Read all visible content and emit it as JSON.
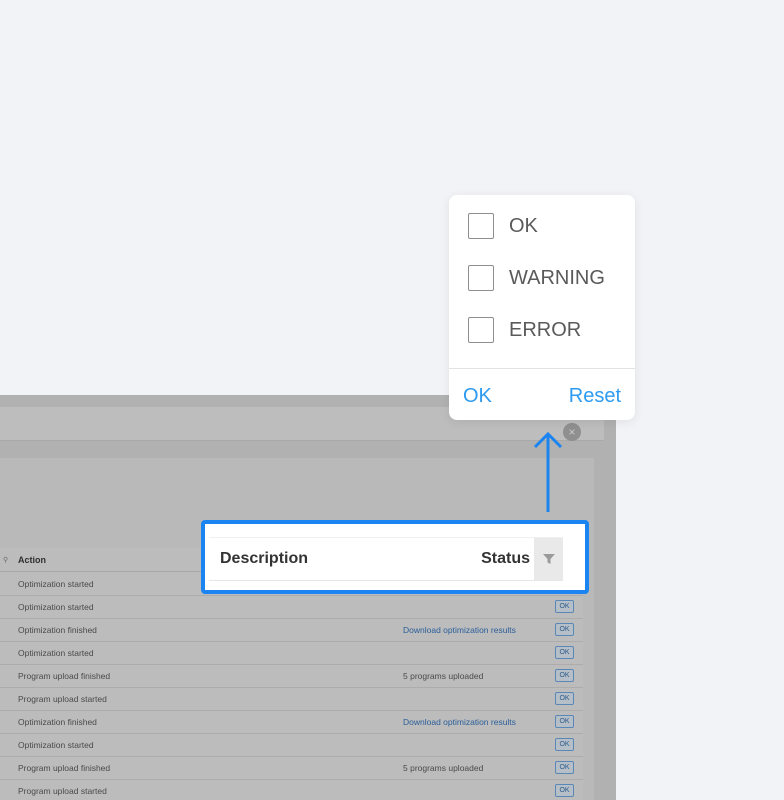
{
  "background_table": {
    "header": {
      "search_icon": "search-icon",
      "action_label": "Action"
    },
    "rows": [
      {
        "action": "Optimization started",
        "description": "",
        "status": ""
      },
      {
        "action": "Optimization started",
        "description": "",
        "status": "OK"
      },
      {
        "action": "Optimization finished",
        "description": "Download optimization results",
        "status": "OK"
      },
      {
        "action": "Optimization started",
        "description": "",
        "status": "OK"
      },
      {
        "action": "Program upload finished",
        "description": "5 programs uploaded",
        "status": "OK"
      },
      {
        "action": "Program upload started",
        "description": "",
        "status": "OK"
      },
      {
        "action": "Optimization finished",
        "description": "Download optimization results",
        "status": "OK"
      },
      {
        "action": "Optimization started",
        "description": "",
        "status": "OK"
      },
      {
        "action": "Program upload finished",
        "description": "5 programs uploaded",
        "status": "OK"
      },
      {
        "action": "Program upload started",
        "description": "",
        "status": "OK"
      }
    ]
  },
  "highlight": {
    "description_label": "Description",
    "status_label": "Status",
    "filter_icon": "filter-icon",
    "border_color": "#1a84f0"
  },
  "filter_popup": {
    "options": [
      {
        "label": "OK",
        "checked": false
      },
      {
        "label": "WARNING",
        "checked": false
      },
      {
        "label": "ERROR",
        "checked": false
      }
    ],
    "ok_label": "OK",
    "reset_label": "Reset",
    "accent_color": "#2e9bf0"
  }
}
